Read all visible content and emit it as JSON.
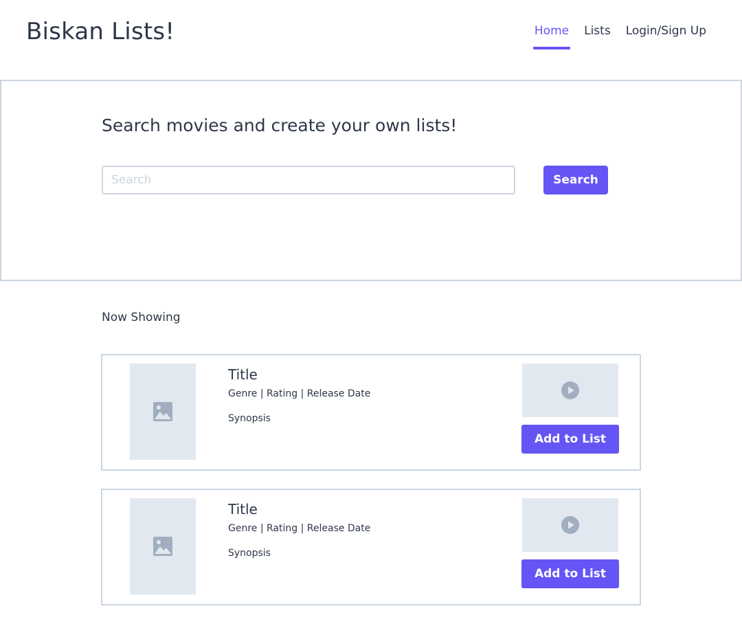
{
  "header": {
    "brand": "Biskan Lists!",
    "nav": [
      {
        "label": "Home",
        "active": true
      },
      {
        "label": "Lists",
        "active": false
      },
      {
        "label": "Login/Sign Up",
        "active": false
      }
    ]
  },
  "hero": {
    "title": "Search movies and create your own lists!",
    "search_placeholder": "Search",
    "search_value": "",
    "search_button": "Search"
  },
  "now_showing": {
    "title": "Now Showing",
    "movies": [
      {
        "title": "Title",
        "meta": "Genre | Rating | Release Date",
        "synopsis": "Synopsis",
        "poster_icon": "image-placeholder-icon",
        "trailer_icon": "play-icon",
        "button": "Add to List"
      },
      {
        "title": "Title",
        "meta": "Genre | Rating | Release Date",
        "synopsis": "Synopsis",
        "poster_icon": "image-placeholder-icon",
        "trailer_icon": "play-icon",
        "button": "Add to List"
      }
    ]
  },
  "colors": {
    "accent": "#6555f5",
    "placeholder_bg": "#e2e8f0",
    "border": "#cbd5e0",
    "text": "#2d3748",
    "icon": "#a0aec0"
  }
}
